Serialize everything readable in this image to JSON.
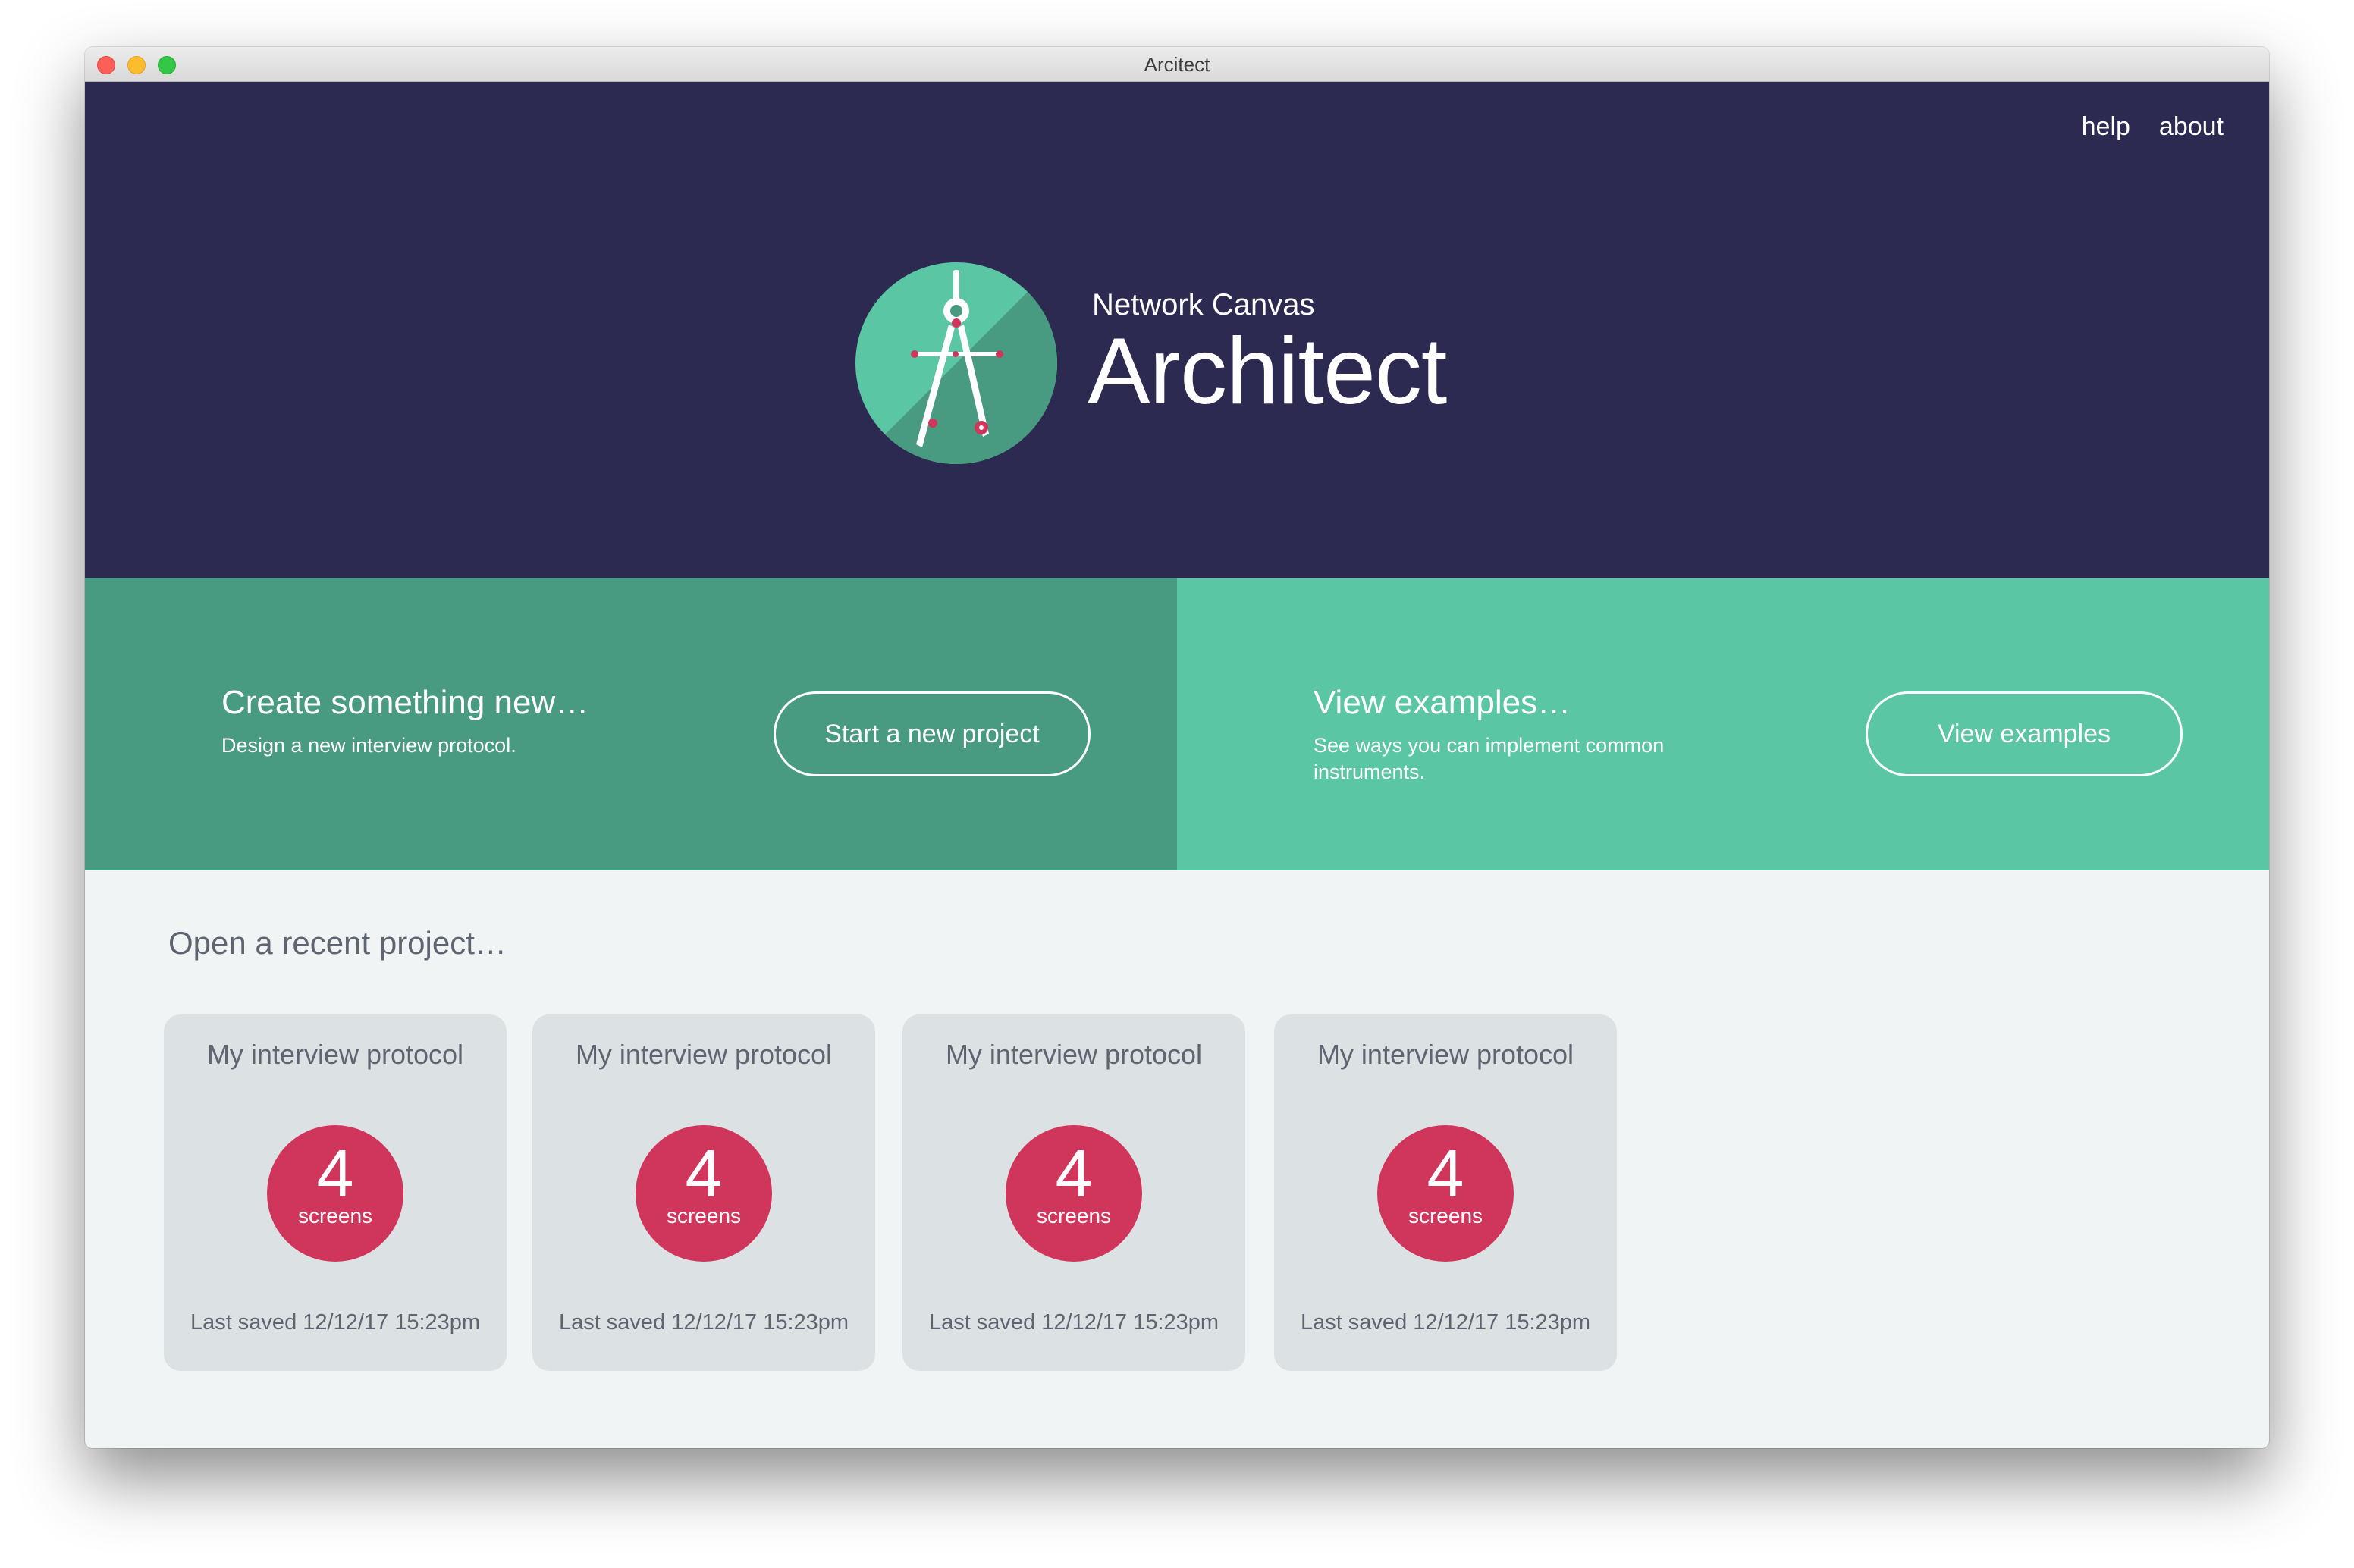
{
  "window": {
    "title": "Arcitect"
  },
  "header": {
    "nav": [
      {
        "label": "help"
      },
      {
        "label": "about"
      }
    ],
    "brand_subtitle": "Network Canvas",
    "brand_title": "Architect",
    "logo_icon": "compass-drawing-icon"
  },
  "actions": {
    "create": {
      "heading": "Create something new…",
      "description": "Design a new interview protocol.",
      "button": "Start a new project"
    },
    "examples": {
      "heading": "View examples…",
      "description": "See ways you can implement common instruments.",
      "button": "View examples"
    }
  },
  "recent": {
    "heading": "Open a recent project…",
    "projects": [
      {
        "title": "My interview protocol",
        "screens": "4",
        "unit": "screens",
        "saved": "Last saved 12/12/17 15:23pm"
      },
      {
        "title": "My interview protocol",
        "screens": "4",
        "unit": "screens",
        "saved": "Last saved 12/12/17 15:23pm"
      },
      {
        "title": "My interview protocol",
        "screens": "4",
        "unit": "screens",
        "saved": "Last saved 12/12/17 15:23pm"
      },
      {
        "title": "My interview protocol",
        "screens": "4",
        "unit": "screens",
        "saved": "Last saved 12/12/17 15:23pm"
      }
    ]
  },
  "colors": {
    "header_bg": "#2d2a52",
    "create_panel_bg": "#489a80",
    "examples_panel_bg": "#5ac6a3",
    "badge_bg": "#d0365c",
    "card_bg": "#dce2e4",
    "body_bg": "#f1f4f4"
  }
}
